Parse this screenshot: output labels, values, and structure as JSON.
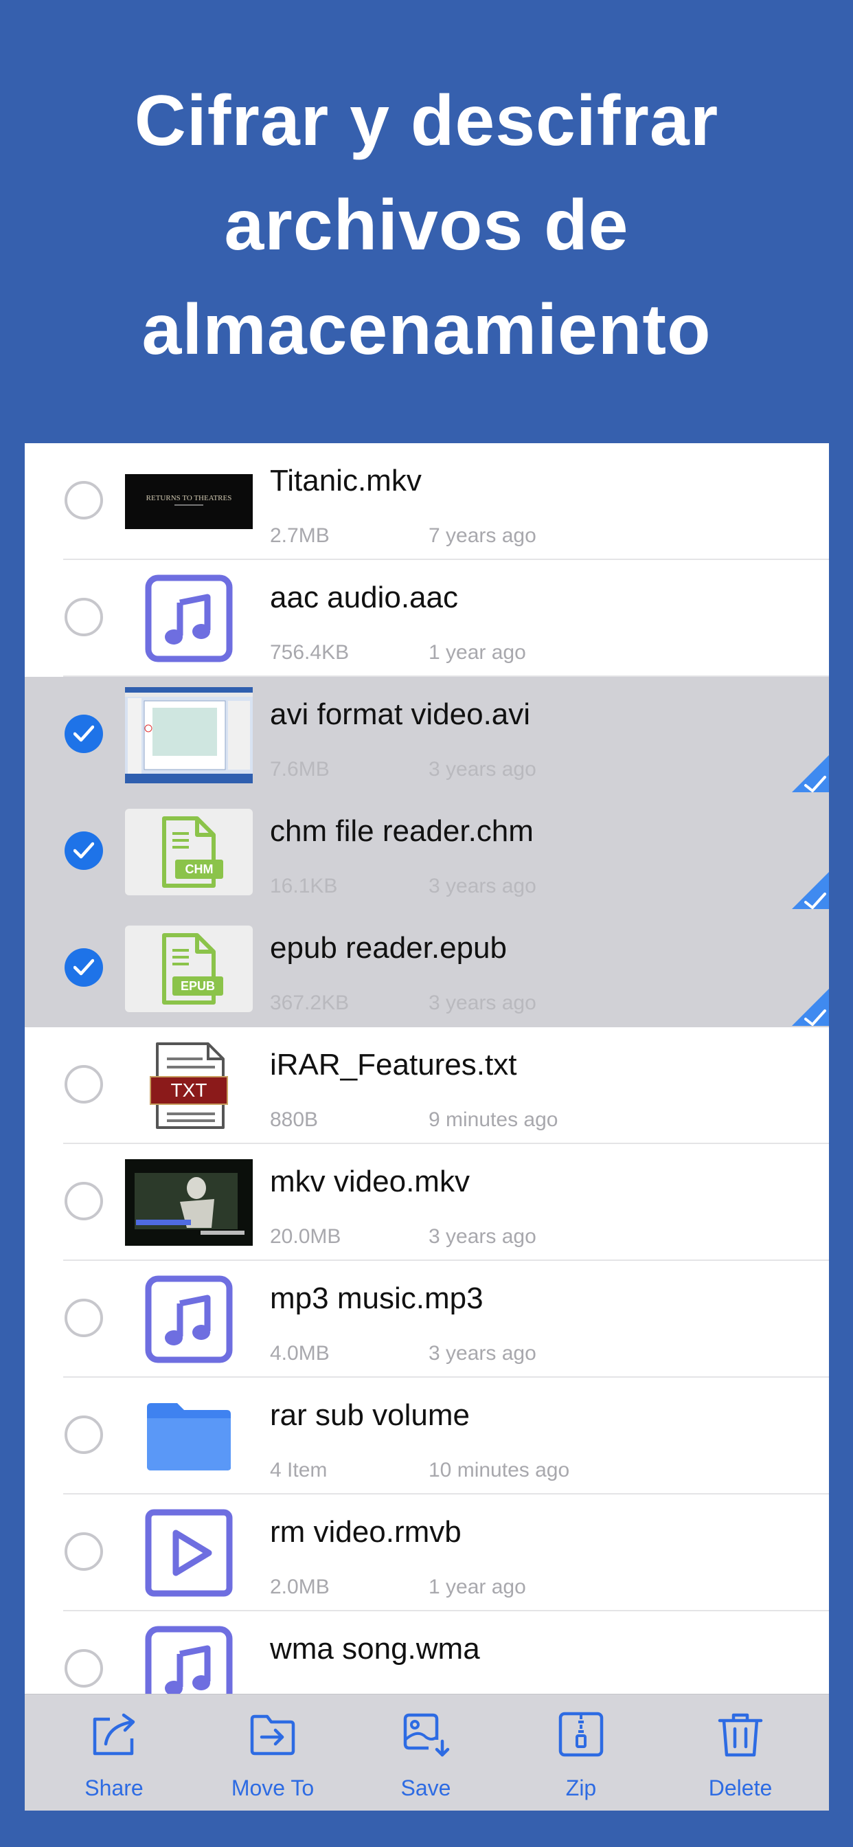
{
  "headline": [
    "Cifrar y descifrar",
    "archivos de",
    "almacenamiento"
  ],
  "colors": {
    "background": "#3660AE",
    "accent": "#2D6BE3",
    "checkbox": "#1E73E8",
    "selected_row": "#D1D1D6",
    "audio_icon": "#6E6EE0",
    "doc_icon": "#8BC34A",
    "folder": "#4C8DF6"
  },
  "files": [
    {
      "name": "Titanic.mkv",
      "size": "2.7MB",
      "date": "7 years ago",
      "selected": false,
      "thumbnail_text": "RETURNS TO THEATRES",
      "icon": "video-thumbnail"
    },
    {
      "name": "aac audio.aac",
      "size": "756.4KB",
      "date": "1 year ago",
      "selected": false,
      "icon": "music-note-icon"
    },
    {
      "name": "avi format video.avi",
      "size": "7.6MB",
      "date": "3 years ago",
      "selected": true,
      "icon": "screenshot-thumbnail"
    },
    {
      "name": "chm file reader.chm",
      "size": "16.1KB",
      "date": "3 years ago",
      "selected": true,
      "badge": "CHM",
      "icon": "document-icon"
    },
    {
      "name": "epub reader.epub",
      "size": "367.2KB",
      "date": "3 years ago",
      "selected": true,
      "badge": "EPUB",
      "icon": "document-icon"
    },
    {
      "name": "iRAR_Features.txt",
      "size": "880B",
      "date": "9 minutes ago",
      "selected": false,
      "badge": "TXT",
      "icon": "text-file-icon"
    },
    {
      "name": "mkv video.mkv",
      "size": "20.0MB",
      "date": "3 years ago",
      "selected": false,
      "icon": "video-thumbnail"
    },
    {
      "name": "mp3 music.mp3",
      "size": "4.0MB",
      "date": "3 years ago",
      "selected": false,
      "icon": "music-note-icon"
    },
    {
      "name": "rar sub volume",
      "size": "4 Item",
      "date": "10 minutes ago",
      "selected": false,
      "icon": "folder-icon"
    },
    {
      "name": "rm video.rmvb",
      "size": "2.0MB",
      "date": "1 year ago",
      "selected": false,
      "icon": "play-icon"
    },
    {
      "name": "wma song.wma",
      "size": "",
      "date": "",
      "selected": false,
      "icon": "music-note-icon"
    }
  ],
  "toolbar": {
    "share_label": "Share",
    "move_to_label": "Move To",
    "save_label": "Save",
    "zip_label": "Zip",
    "delete_label": "Delete"
  }
}
